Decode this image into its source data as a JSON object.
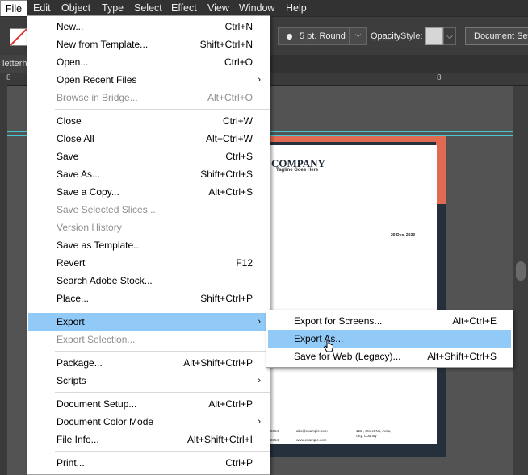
{
  "menubar": {
    "items": [
      {
        "label": "File",
        "active": true
      },
      {
        "label": "Edit"
      },
      {
        "label": "Object"
      },
      {
        "label": "Type"
      },
      {
        "label": "Select"
      },
      {
        "label": "Effect"
      },
      {
        "label": "View"
      },
      {
        "label": "Window"
      },
      {
        "label": "Help"
      }
    ]
  },
  "control_bar": {
    "brush_label": "5 pt. Round",
    "opacity_label": "Opacity",
    "style_label": "Style:",
    "document_setup_label": "Document Setu"
  },
  "tab": {
    "label": "letterh"
  },
  "rulers": {
    "ticks": [
      "8",
      "8",
      "8"
    ]
  },
  "document": {
    "company": "COMPANY",
    "tagline": "Tagline Goes Here",
    "date": "20 Dec, 2023",
    "footer": [
      "2354",
      "abc@example.com",
      "123 , Street No, Area,",
      "City, Country",
      "2354",
      "www.example.com"
    ]
  },
  "file_menu": {
    "items": [
      {
        "label": "New...",
        "shortcut": "Ctrl+N"
      },
      {
        "label": "New from Template...",
        "shortcut": "Shift+Ctrl+N"
      },
      {
        "label": "Open...",
        "shortcut": "Ctrl+O"
      },
      {
        "label": "Open Recent Files",
        "shortcut": "",
        "submenu": true
      },
      {
        "label": "Browse in Bridge...",
        "shortcut": "Alt+Ctrl+O",
        "disabled": true
      },
      {
        "label": "Close",
        "shortcut": "Ctrl+W"
      },
      {
        "label": "Close All",
        "shortcut": "Alt+Ctrl+W"
      },
      {
        "label": "Save",
        "shortcut": "Ctrl+S"
      },
      {
        "label": "Save As...",
        "shortcut": "Shift+Ctrl+S"
      },
      {
        "label": "Save a Copy...",
        "shortcut": "Alt+Ctrl+S"
      },
      {
        "label": "Save Selected Slices...",
        "shortcut": "",
        "disabled": true
      },
      {
        "label": "Version History",
        "shortcut": "",
        "disabled": true
      },
      {
        "label": "Save as Template...",
        "shortcut": ""
      },
      {
        "label": "Revert",
        "shortcut": "F12"
      },
      {
        "label": "Search Adobe Stock...",
        "shortcut": ""
      },
      {
        "label": "Place...",
        "shortcut": "Shift+Ctrl+P"
      },
      {
        "label": "Export",
        "shortcut": "",
        "submenu": true,
        "highlighted": true
      },
      {
        "label": "Export Selection...",
        "shortcut": "",
        "disabled": true
      },
      {
        "label": "Package...",
        "shortcut": "Alt+Shift+Ctrl+P"
      },
      {
        "label": "Scripts",
        "shortcut": "",
        "submenu": true
      },
      {
        "label": "Document Setup...",
        "shortcut": "Alt+Ctrl+P"
      },
      {
        "label": "Document Color Mode",
        "shortcut": "",
        "submenu": true
      },
      {
        "label": "File Info...",
        "shortcut": "Alt+Shift+Ctrl+I"
      },
      {
        "label": "Print...",
        "shortcut": "Ctrl+P"
      }
    ]
  },
  "export_submenu": {
    "items": [
      {
        "label": "Export for Screens...",
        "shortcut": "Alt+Ctrl+E"
      },
      {
        "label": "Export As...",
        "shortcut": "",
        "highlighted": true
      },
      {
        "label": "Save for Web (Legacy)...",
        "shortcut": "Alt+Shift+Ctrl+S"
      }
    ]
  },
  "colors": {
    "menu_highlight": "#91c9f7",
    "accent_orange": "#e06b52",
    "guide_cyan": "#46c8d0"
  }
}
